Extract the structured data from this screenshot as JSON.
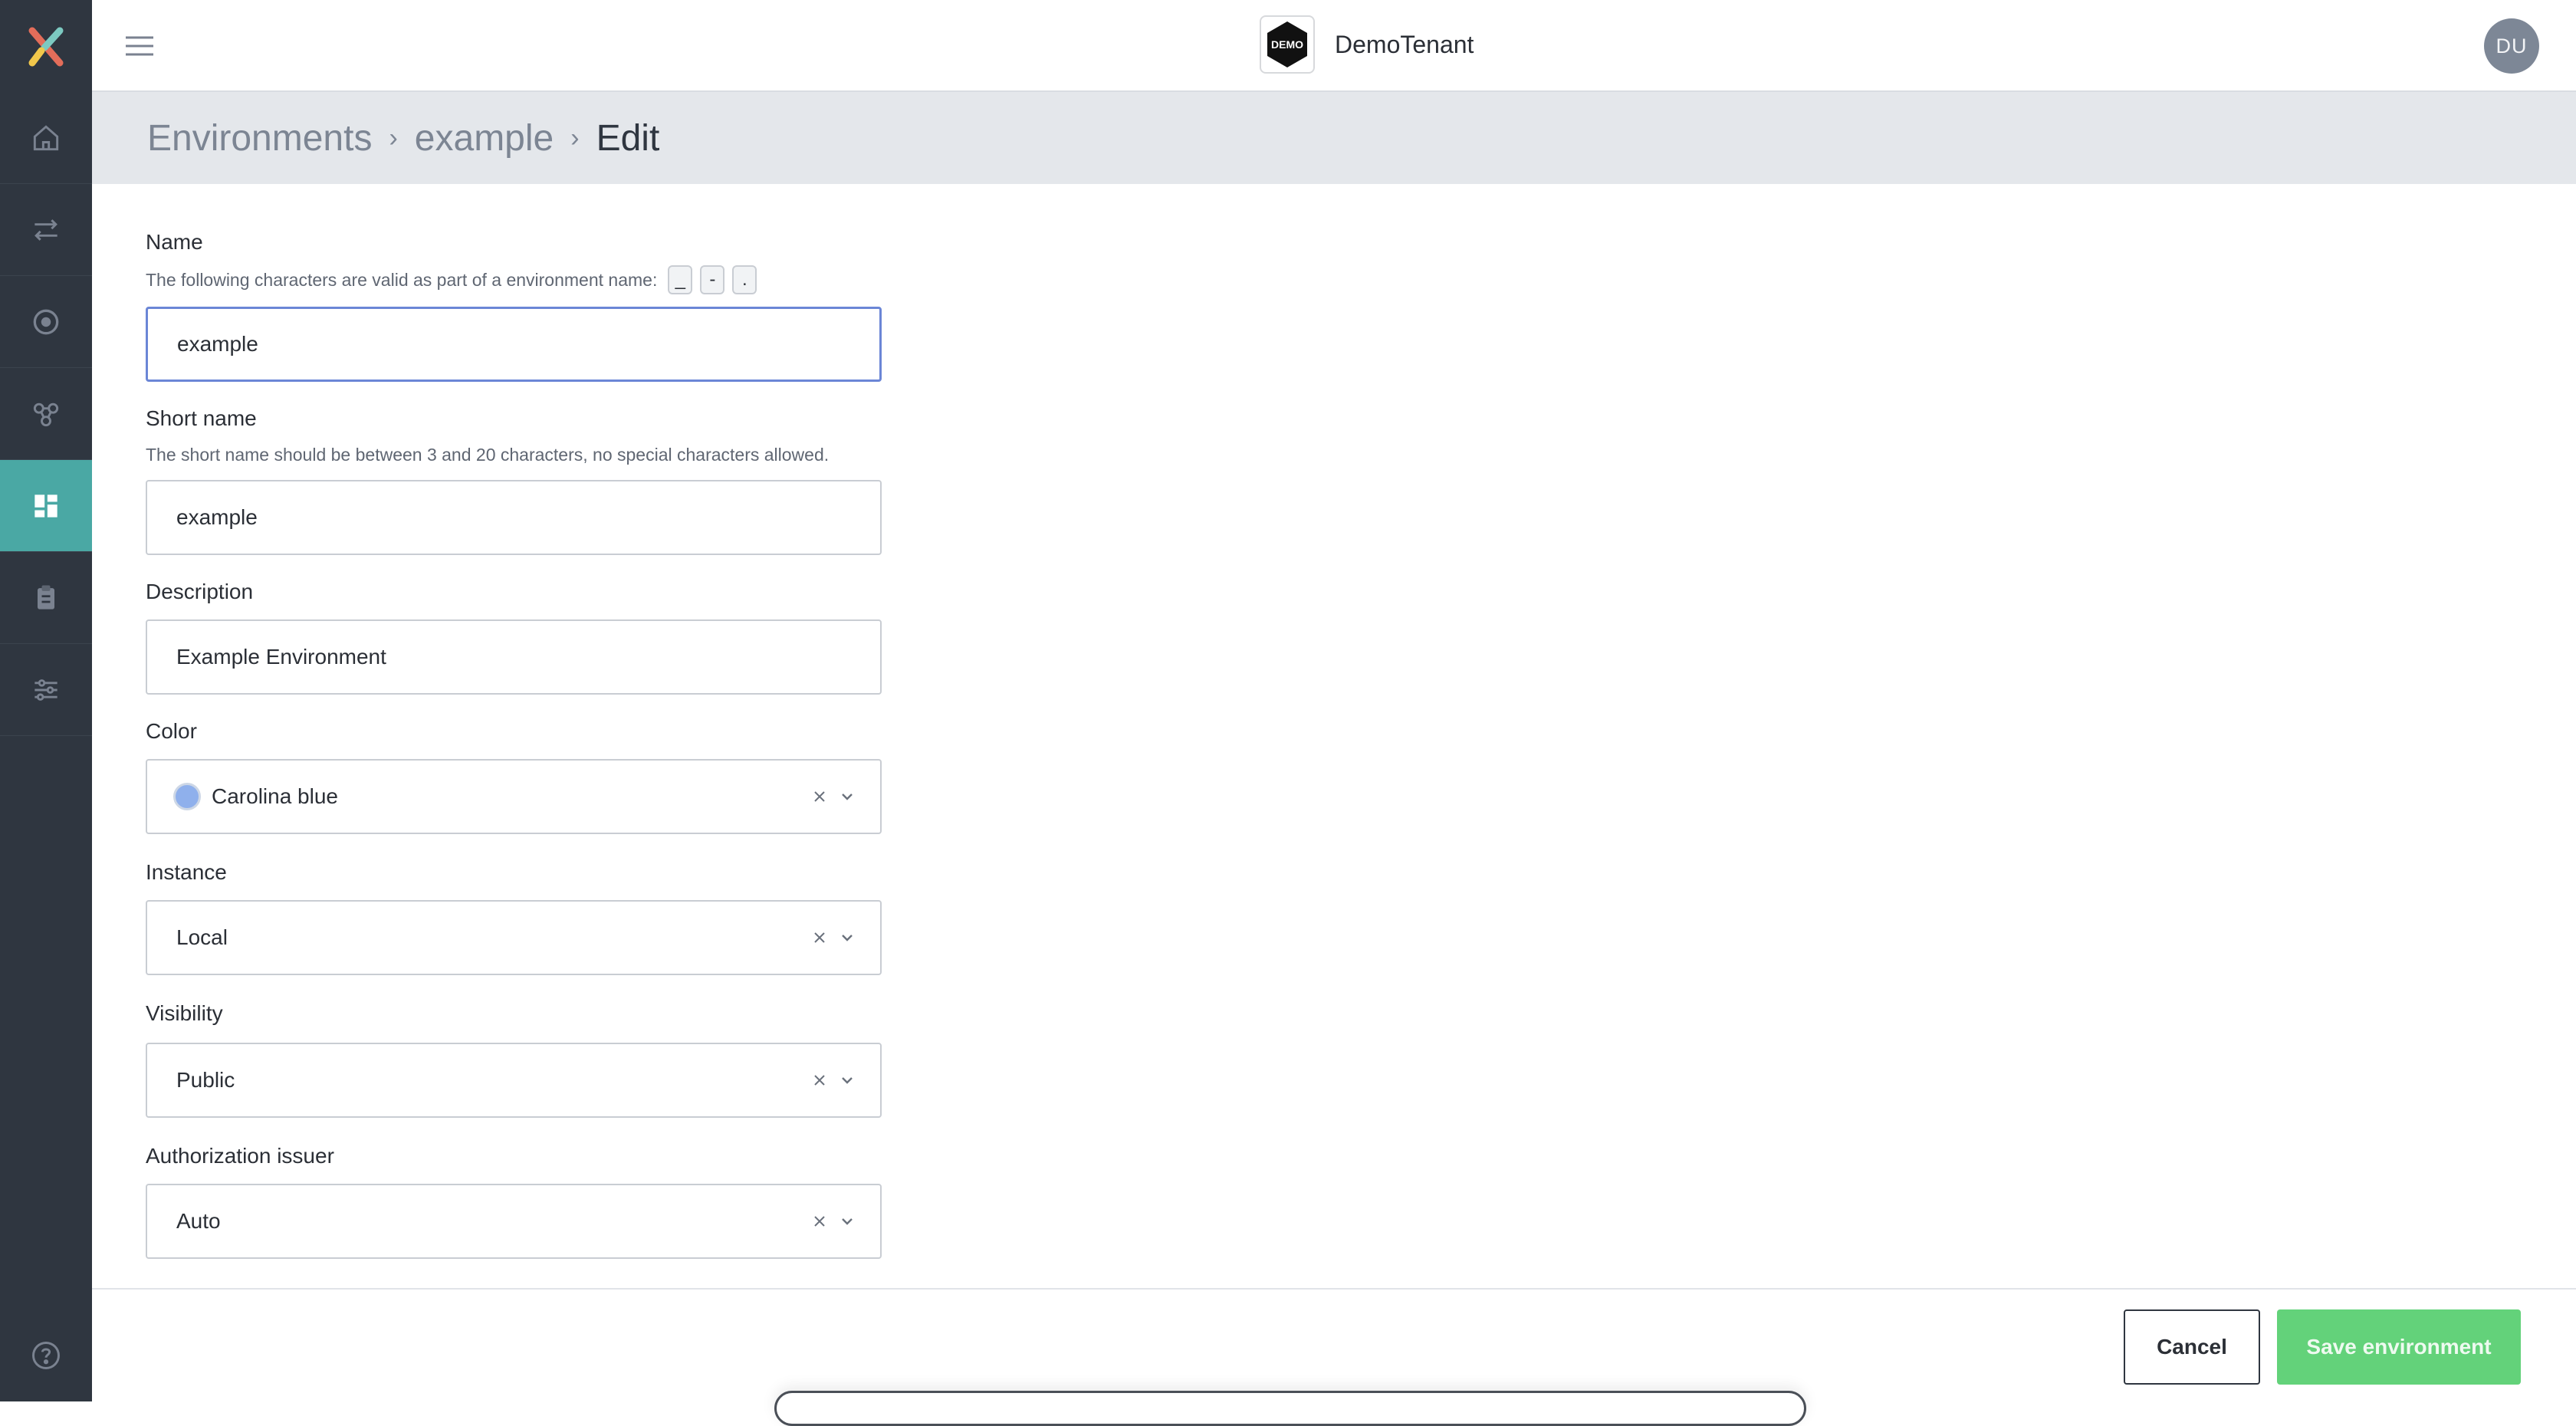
{
  "app": {
    "name": "DemoTenant",
    "tenant_logo_text": "DEMO",
    "user_initials": "DU"
  },
  "sidebar": {
    "items": [
      {
        "icon": "home-icon"
      },
      {
        "icon": "arrows-exchange-icon"
      },
      {
        "icon": "target-circle-icon"
      },
      {
        "icon": "network-nodes-icon"
      },
      {
        "icon": "grid-dashboard-icon",
        "active": true
      },
      {
        "icon": "clipboard-icon"
      },
      {
        "icon": "sliders-icon"
      }
    ],
    "help_icon": "help-icon"
  },
  "breadcrumb": {
    "root": "Environments",
    "item": "example",
    "current": "Edit"
  },
  "form": {
    "name": {
      "label": "Name",
      "hint": "The following characters are valid as part of a environment name:",
      "chars": [
        "_",
        "-",
        "."
      ],
      "value": "example"
    },
    "short_name": {
      "label": "Short name",
      "hint": "The short name should be between 3 and 20 characters, no special characters allowed.",
      "value": "example"
    },
    "description": {
      "label": "Description",
      "value": "Example Environment"
    },
    "color": {
      "label": "Color",
      "value": "Carolina blue",
      "swatch": "#8fb0ec"
    },
    "instance": {
      "label": "Instance",
      "value": "Local"
    },
    "visibility": {
      "label": "Visibility",
      "value": "Public"
    },
    "authorization_issuer": {
      "label": "Authorization issuer",
      "value": "Auto"
    }
  },
  "footer": {
    "cancel_label": "Cancel",
    "save_label": "Save environment"
  },
  "colors": {
    "sidebar": "#2f3640",
    "active": "#4aa8a4",
    "save": "#63d27a",
    "focus": "#6b86d6"
  }
}
